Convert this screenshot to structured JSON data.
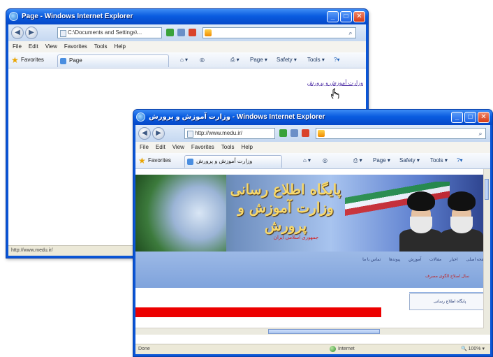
{
  "window_back": {
    "title": "Page - Windows Internet Explorer",
    "address": "C:\\Documents and Settings\\...",
    "menu": [
      "File",
      "Edit",
      "View",
      "Favorites",
      "Tools",
      "Help"
    ],
    "favorites_label": "Favorites",
    "tab_label": "Page",
    "toolbar_cmds": [
      "Page ▾",
      "Safety ▾",
      "Tools ▾"
    ],
    "link_text": "وزارت آموزش و پرورش",
    "status_text": "http://www.medu.ir/"
  },
  "window_front": {
    "title": "وزارت آموزش و پرورش - Windows Internet Explorer",
    "address": "http://www.medu.ir/",
    "menu": [
      "File",
      "Edit",
      "View",
      "Favorites",
      "Tools",
      "Help"
    ],
    "favorites_label": "Favorites",
    "tab_label": "وزارت آموزش و پرورش",
    "toolbar_cmds": [
      "Page ▾",
      "Safety ▾",
      "Tools ▾"
    ],
    "banner_title": "پایگاه اطلاع رسانی وزارت آموزش و پرورش",
    "banner_subtitle": "جمهوری اسلامی ایران",
    "nav_items": [
      "صفحه اصلی",
      "اخبار",
      "مقالات",
      "آموزش",
      "پیوندها",
      "تماس با ما"
    ],
    "marquee": "سال اصلاح الگوی مصرف",
    "right_box": "پایگاه اطلاع رسانی",
    "status_left": "Done",
    "status_zone": "Internet",
    "zoom": "100%"
  },
  "colors": {
    "title_blue": "#0a5ce0",
    "link_purple": "#4e2fa6",
    "red_bar": "#ec0000",
    "nav_blue": "#9cb9e6"
  }
}
